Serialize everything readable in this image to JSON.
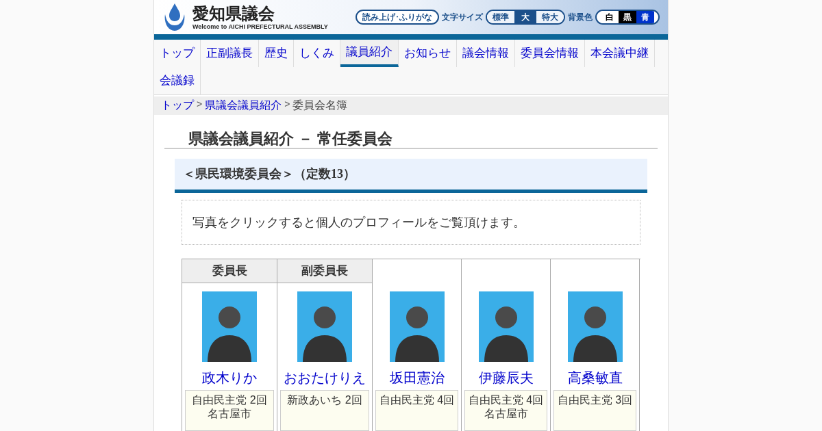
{
  "header": {
    "title": "愛知県議会",
    "subtitle": "Welcome to AICHI PREFECTURAL ASSEMBLY",
    "reader_button": "読み上げ･ふりがな",
    "font_size_label": "文字サイズ",
    "font_sizes": [
      {
        "label": "標準",
        "selected": false
      },
      {
        "label": "大",
        "selected": true
      },
      {
        "label": "特大",
        "selected": false
      }
    ],
    "background_label": "背景色",
    "backgrounds": [
      {
        "label": "白",
        "color": "#ffffff"
      },
      {
        "label": "黒",
        "color": "#000000"
      },
      {
        "label": "青",
        "color": "#0033cc"
      }
    ]
  },
  "nav": [
    {
      "label": "トップ",
      "selected": false
    },
    {
      "label": "正副議長",
      "selected": false
    },
    {
      "label": "歴史",
      "selected": false
    },
    {
      "label": "しくみ",
      "selected": false
    },
    {
      "label": "議員紹介",
      "selected": true
    },
    {
      "label": "お知らせ",
      "selected": false
    },
    {
      "label": "議会情報",
      "selected": false
    },
    {
      "label": "委員会情報",
      "selected": false
    },
    {
      "label": "本会議中継",
      "selected": false
    },
    {
      "label": "会議録",
      "selected": false
    }
  ],
  "breadcrumb": {
    "links": [
      "トップ",
      "県議会議員紹介"
    ],
    "separator": ">",
    "current": "委員会名簿"
  },
  "page_title": "県議会議員紹介 － 常任委員会",
  "committee": "＜県民環境委員会＞（定数13）",
  "notice": "写真をクリックすると個人のプロフィールをご覧頂けます。",
  "members": [
    {
      "role": "委員長",
      "name": "政木りか",
      "party": "自由民主党 2回",
      "city": "名古屋市"
    },
    {
      "role": "副委員長",
      "name": "おおたけりえ",
      "party": "新政あいち 2回"
    },
    {
      "name": "坂田憲治",
      "party": "自由民主党 4回"
    },
    {
      "name": "伊藤辰夫",
      "party": "自由民主党 4回",
      "city": "名古屋市"
    },
    {
      "name": "高桑敏直",
      "party": "自由民主党 3回"
    }
  ]
}
